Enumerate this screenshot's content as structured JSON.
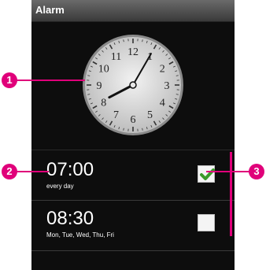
{
  "app": {
    "title": "Alarm"
  },
  "clock": {
    "numerals": [
      "12",
      "1",
      "2",
      "3",
      "4",
      "5",
      "6",
      "7",
      "8",
      "9",
      "10",
      "11"
    ],
    "hour": 8,
    "minute": 5
  },
  "alarms": [
    {
      "time": "07:00",
      "days": "every day",
      "checked": true
    },
    {
      "time": "08:30",
      "days": "Mon, Tue, Wed, Thu, Fri",
      "checked": false
    }
  ],
  "callouts": [
    "1",
    "2",
    "3"
  ],
  "colors": {
    "accent": "#e0007a",
    "check": "#3a9a2a",
    "background": "#0d0d0d"
  }
}
